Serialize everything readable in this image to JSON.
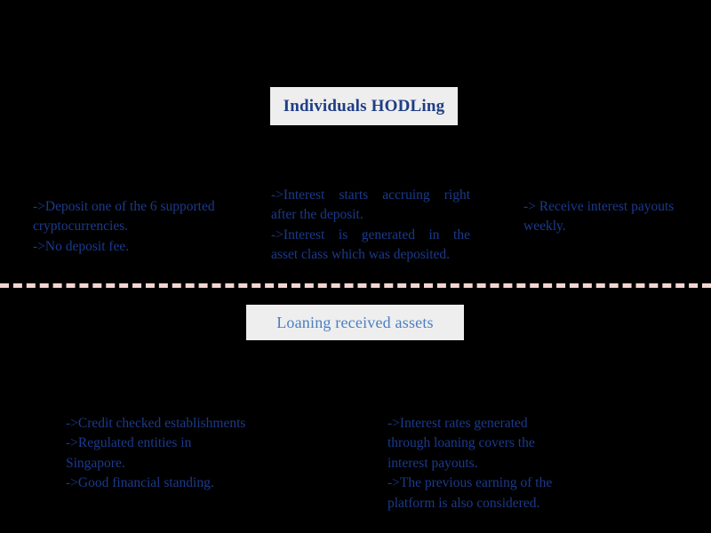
{
  "theme": {
    "background": "#000000",
    "box_background": "#eeeeee",
    "text_blue_dark": "#1b3a8c",
    "title_blue": "#1f3e84",
    "subtitle_blue": "#4a7fc1",
    "divider_color": "#f2d6d0"
  },
  "sections": {
    "top": {
      "title": "Individuals HODLing",
      "notes": {
        "deposit": [
          "->Deposit one of the 6 supported",
          "cryptocurrencies.",
          "->No deposit fee."
        ],
        "interest": [
          "->Interest starts accruing right",
          "after the deposit.",
          "->Interest is generated in the",
          "asset class which was deposited."
        ],
        "payouts": [
          "-> Receive interest payouts",
          "weekly."
        ]
      }
    },
    "bottom": {
      "title": "Loaning received assets",
      "notes": {
        "credit": [
          "->Credit checked establishments",
          "->Regulated entities in",
          "Singapore.",
          "->Good financial standing."
        ],
        "rates": [
          "->Interest rates generated",
          "through loaning covers the",
          "interest payouts.",
          "->The previous earning of the",
          "platform is also considered."
        ]
      }
    }
  }
}
